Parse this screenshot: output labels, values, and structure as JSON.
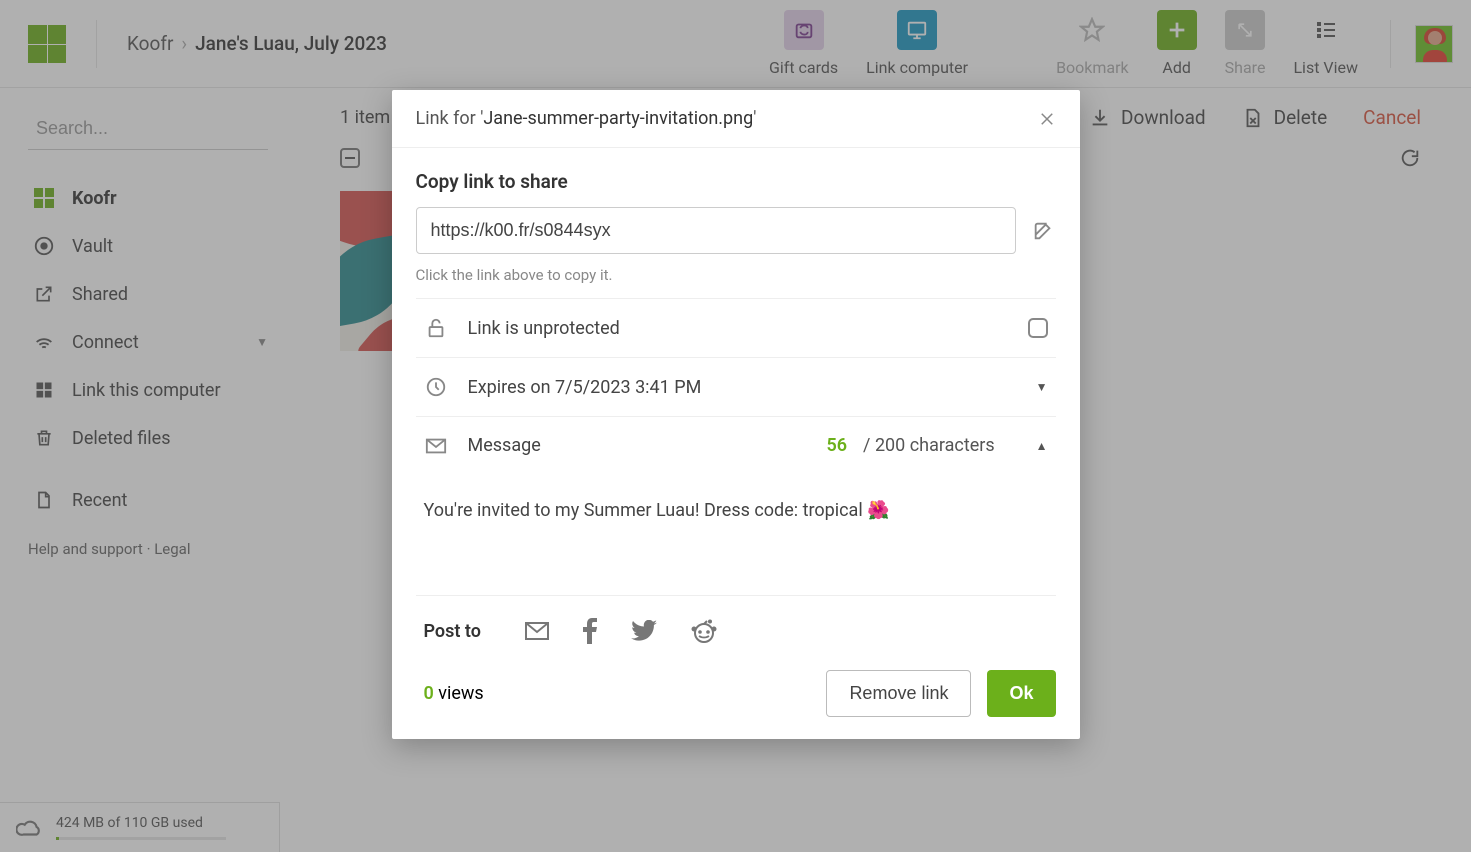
{
  "breadcrumb": {
    "root": "Koofr",
    "current": "Jane's Luau, July 2023"
  },
  "topActions": {
    "gift": "Gift cards",
    "link": "Link computer",
    "bookmark": "Bookmark",
    "add": "Add",
    "share": "Share",
    "listview": "List View"
  },
  "sidebar": {
    "searchPlaceholder": "Search...",
    "items": {
      "koofr": "Koofr",
      "vault": "Vault",
      "shared": "Shared",
      "connect": "Connect",
      "linkComputer": "Link this computer",
      "deleted": "Deleted files",
      "recent": "Recent"
    },
    "help": "Help and support",
    "legal": "Legal"
  },
  "content": {
    "count": "1 item",
    "download": "Download",
    "delete": "Delete",
    "cancel": "Cancel"
  },
  "storage": {
    "text": "424 MB of 110 GB used"
  },
  "modal": {
    "titlePrefix": "Link for '",
    "filename": "Jane-summer-party-invitation.png",
    "titleSuffix": "'",
    "copySection": "Copy link to share",
    "link": "https://k00.fr/s0844syx",
    "hint": "Click the link above to copy it.",
    "protection": "Link is unprotected",
    "expires": "Expires on 7/5/2023 3:41 PM",
    "messageLabel": "Message",
    "charCount": "56",
    "charSuffix": " / 200 characters",
    "messageText": "You're invited to my Summer Luau! Dress code: tropical 🌺",
    "postTo": "Post to",
    "viewsN": "0",
    "viewsLabel": " views",
    "removeBtn": "Remove link",
    "okBtn": "Ok"
  }
}
